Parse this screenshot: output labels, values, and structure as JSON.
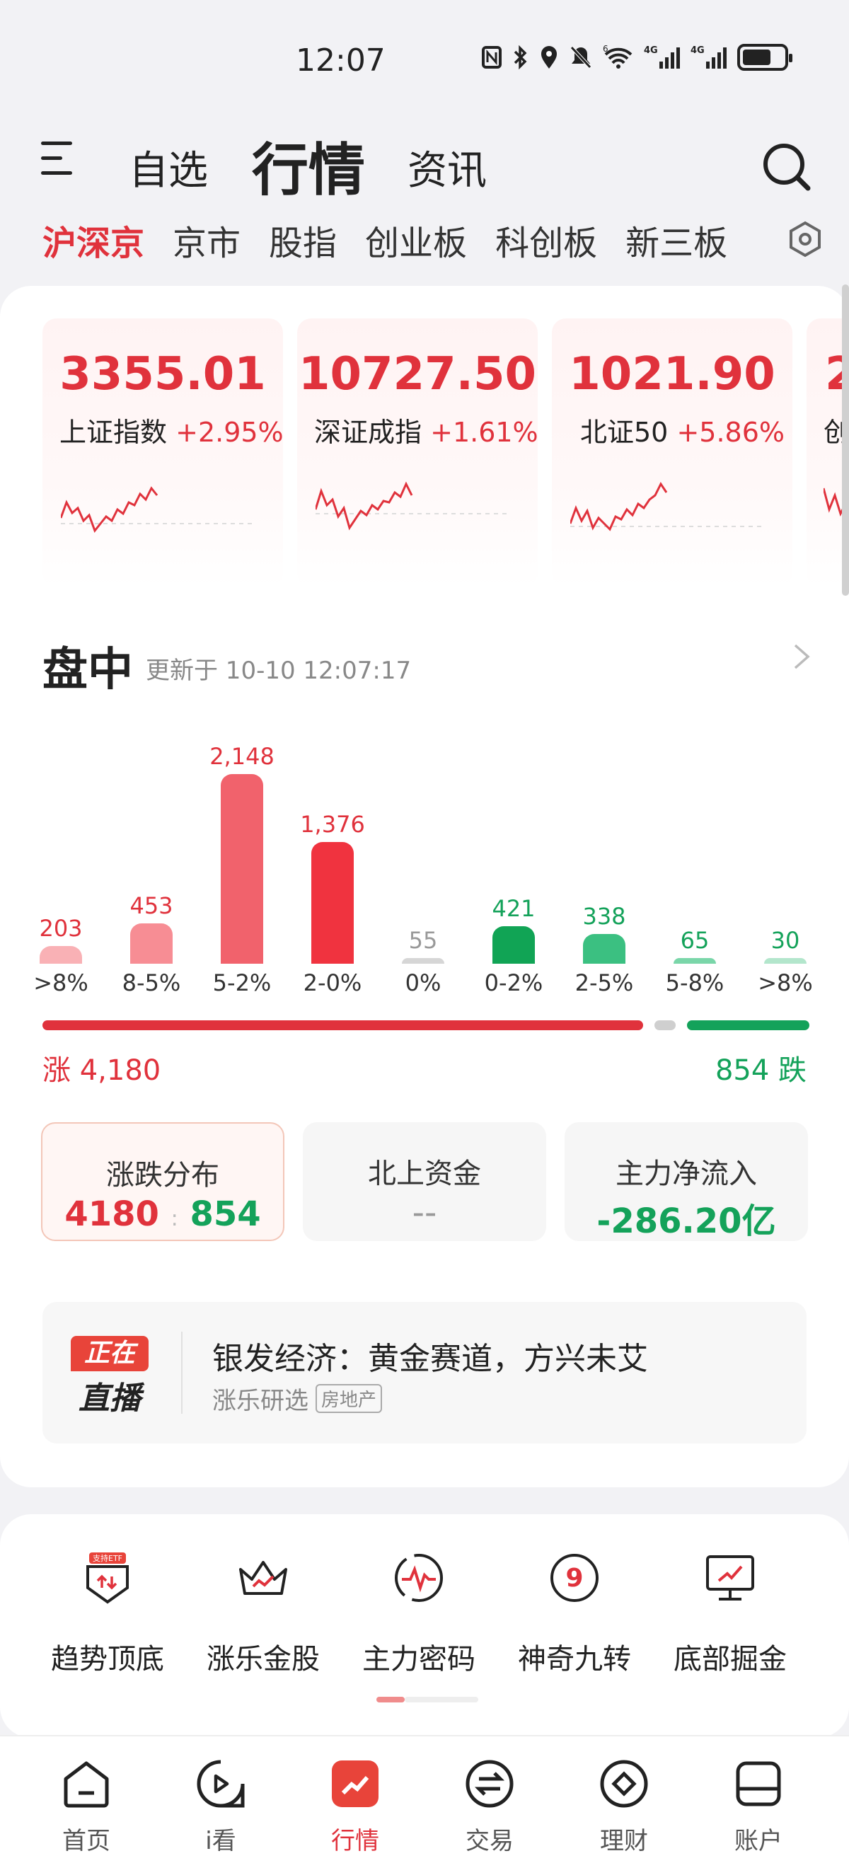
{
  "status_bar": {
    "time": "12:07",
    "icons": [
      "nfc-icon",
      "bluetooth-icon",
      "location-icon",
      "mute-icon",
      "wifi-icon",
      "signal-icon",
      "signal-icon",
      "battery-icon"
    ],
    "wifi_label": "6",
    "sig1": "4G",
    "sig2": "4G"
  },
  "header": {
    "tabs": [
      {
        "label": "自选"
      },
      {
        "label": "行情"
      },
      {
        "label": "资讯"
      }
    ],
    "active_tab": "行情"
  },
  "sub_tabs": [
    "沪深京",
    "京市",
    "股指",
    "创业板",
    "科创板",
    "新三板"
  ],
  "indices": [
    {
      "value": "3355.01",
      "name": "上证指数",
      "change": "+2.95%"
    },
    {
      "value": "10727.50",
      "name": "深证成指",
      "change": "+1.61%"
    },
    {
      "value": "1021.90",
      "name": "北证50",
      "change": "+5.86%"
    },
    {
      "value": "2",
      "name": "创",
      "change": ""
    }
  ],
  "section": {
    "title": "盘中",
    "updated": "更新于 10-10 12:07:17"
  },
  "chart_data": {
    "type": "bar",
    "categories": [
      ">8%",
      "8-5%",
      "5-2%",
      "2-0%",
      "0%",
      "0-2%",
      "2-5%",
      "5-8%",
      ">8%"
    ],
    "values": [
      203,
      453,
      2148,
      1376,
      55,
      421,
      338,
      65,
      30
    ],
    "value_labels": [
      "203",
      "453",
      "2,148",
      "1,376",
      "55",
      "421",
      "338",
      "65",
      "30"
    ],
    "colors": [
      "#f9b1b5",
      "#f78d94",
      "#f1626c",
      "#f0333f",
      "#d6d6d6",
      "#11a455",
      "#3bc081",
      "#7ad6a9",
      "#b3e6cc"
    ],
    "label_colors": [
      "#e0323c",
      "#e0323c",
      "#e0323c",
      "#e0323c",
      "#999999",
      "#14a25a",
      "#14a25a",
      "#14a25a",
      "#14a25a"
    ],
    "ylim": [
      0,
      2148
    ]
  },
  "breadth": {
    "up_label": "涨 4,180",
    "down_label": "854 跌",
    "up": 4180,
    "flat": 146,
    "down": 854
  },
  "stats": [
    {
      "label": "涨跌分布",
      "up": "4180",
      "sep": ":",
      "down": "854"
    },
    {
      "label": "北上资金",
      "value": "--"
    },
    {
      "label": "主力净流入",
      "value": "-286.20亿"
    }
  ],
  "live": {
    "badge_top": "正在",
    "badge_bottom": "直播",
    "title": "银发经济：黄金赛道，方兴未艾",
    "source": "涨乐研选",
    "tag": "房地产"
  },
  "tools": [
    {
      "label": "趋势顶底",
      "badge": "支持ETF",
      "icon": "trend-icon"
    },
    {
      "label": "涨乐金股",
      "icon": "crown-icon"
    },
    {
      "label": "主力密码",
      "icon": "pulse-icon"
    },
    {
      "label": "神奇九转",
      "icon": "nine-icon"
    },
    {
      "label": "底部掘金",
      "icon": "monitor-icon"
    }
  ],
  "bottom_nav": [
    {
      "label": "首页",
      "icon": "home-icon"
    },
    {
      "label": "i看",
      "icon": "play-icon"
    },
    {
      "label": "行情",
      "icon": "market-icon"
    },
    {
      "label": "交易",
      "icon": "trade-icon"
    },
    {
      "label": "理财",
      "icon": "wealth-icon"
    },
    {
      "label": "账户",
      "icon": "account-icon"
    }
  ],
  "colors": {
    "up": "#e0323c",
    "down": "#14a25a",
    "accent": "#e0323c"
  }
}
